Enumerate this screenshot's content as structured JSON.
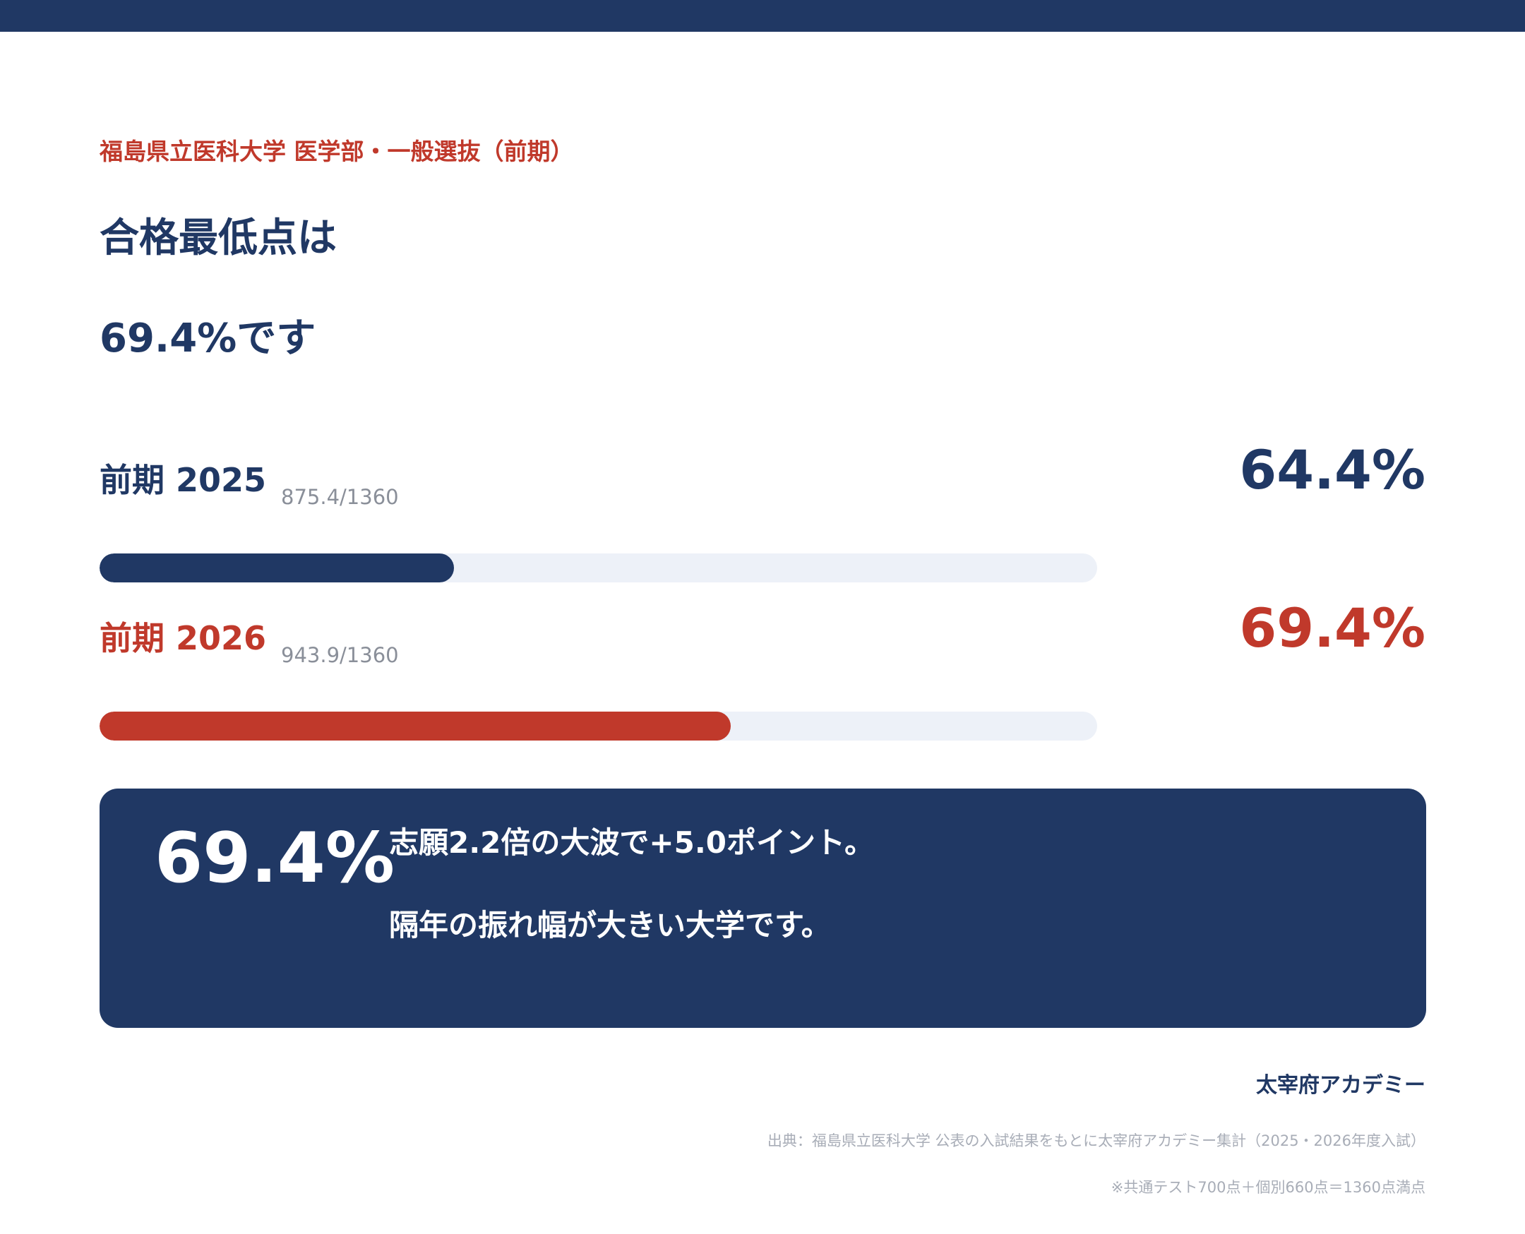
{
  "header": {
    "subtitle": "福島県立医科大学 医学部・一般選抜（前期）",
    "headline_line1": "合格最低点は",
    "headline_line2": "69.4%です"
  },
  "rows": [
    {
      "label": "前期 2025",
      "score": "875.4/1360",
      "percent_text": "64.4%",
      "bar_fill_fraction": 0.355,
      "color": "#203864"
    },
    {
      "label": "前期 2026",
      "score": "943.9/1360",
      "percent_text": "69.4%",
      "bar_fill_fraction": 0.633,
      "color": "#c0392b"
    }
  ],
  "card": {
    "percent": "69.4%",
    "line1": "志願2.2倍の大波で+5.0ポイント。",
    "line2": "隔年の振れ幅が大きい大学です。"
  },
  "footer": {
    "brand": "太宰府アカデミー",
    "source": "出典：福島県立医科大学 公表の入試結果をもとに太宰府アカデミー集計（2025・2026年度入試）",
    "note": "※共通テスト700点＋個別660点＝1360点満点"
  },
  "colors": {
    "navy": "#203864",
    "red": "#c0392b",
    "track": "#edf1f8"
  }
}
